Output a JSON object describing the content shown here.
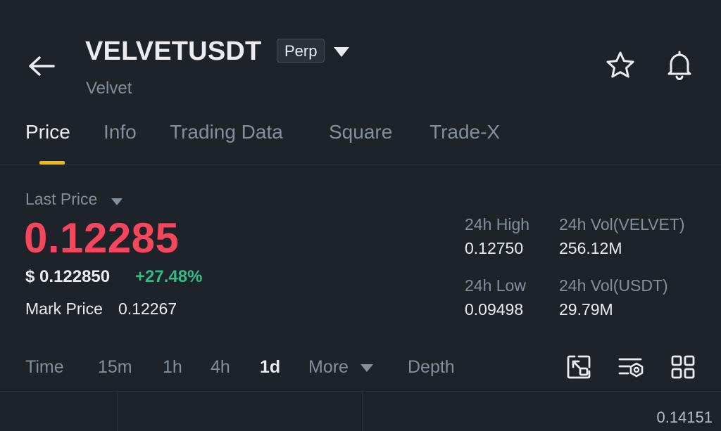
{
  "header": {
    "symbol": "VELVETUSDT",
    "badge": "Perp",
    "subname": "Velvet",
    "icons": [
      "back-arrow-icon",
      "caret-down-icon",
      "star-icon",
      "bell-icon"
    ]
  },
  "tabs": [
    {
      "label": "Price",
      "active": true
    },
    {
      "label": "Info"
    },
    {
      "label": "Trading Data"
    },
    {
      "label": "Square"
    },
    {
      "label": "Trade-X"
    }
  ],
  "price": {
    "last_price_label": "Last Price",
    "last_price": "0.12285",
    "usd_price": "$ 0.122850",
    "change": "+27.48%",
    "mark_price_label": "Mark Price",
    "mark_price": "0.12267"
  },
  "stats": {
    "high_label": "24h High",
    "high_value": "0.12750",
    "vol_base_label": "24h Vol(VELVET)",
    "vol_base_value": "256.12M",
    "low_label": "24h Low",
    "low_value": "0.09498",
    "vol_quote_label": "24h Vol(USDT)",
    "vol_quote_value": "29.79M"
  },
  "intervals": {
    "time": "Time",
    "m15": "15m",
    "h1": "1h",
    "h4": "4h",
    "d1": "1d",
    "more": "More",
    "depth": "Depth",
    "active": "1d",
    "tool_icons": [
      "fullscreen-icon",
      "indicator-settings-icon",
      "grid-layout-icon"
    ]
  },
  "chart": {
    "axis_top_value": "0.14151"
  },
  "colors": {
    "background": "#1e2329",
    "down_red": "#f6465d",
    "up_green": "#2ebd85",
    "accent_yellow": "#f0b90b",
    "muted_text": "#848e9c"
  }
}
